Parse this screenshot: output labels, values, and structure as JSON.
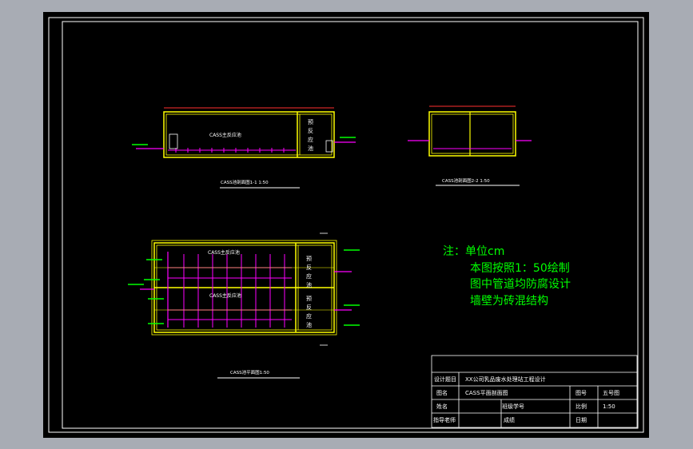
{
  "notes": {
    "line1": "注：单位cm",
    "line2": "本图按照1：50绘制",
    "line3": "图中管道均防腐设计",
    "line4": "墙壁为砖混结构"
  },
  "views": {
    "section1_title": "CASS池剖面图1-1 1:50",
    "section2_title": "CASS池剖面图2-2 1:50",
    "plan_title": "CASS池平面图1:50",
    "main_zone_label": "CASS主反应池",
    "pre_zone_label": "预反应池"
  },
  "titleblock": {
    "r1_label": "设计题目",
    "r1_value": "XX公司乳品废水处理站工程设计",
    "r2_label": "图名",
    "r2_value": "CASS平面剖面图",
    "r2_label2": "图号",
    "r2_value2": "五号图",
    "r3_label": "姓名",
    "r3_mid_label": "班级学号",
    "r3_label2": "比例",
    "r3_value2": "1:50",
    "r4_label": "指导老师",
    "r4_mid_label": "成绩",
    "r4_label2": "日期"
  },
  "colors": {
    "sheet": "#000000",
    "background": "#a8acb4",
    "wall": "#ffff00",
    "pipe": "#ff00ff",
    "text_white": "#ffffff",
    "note": "#00ff00",
    "dim": "#ff3030"
  }
}
